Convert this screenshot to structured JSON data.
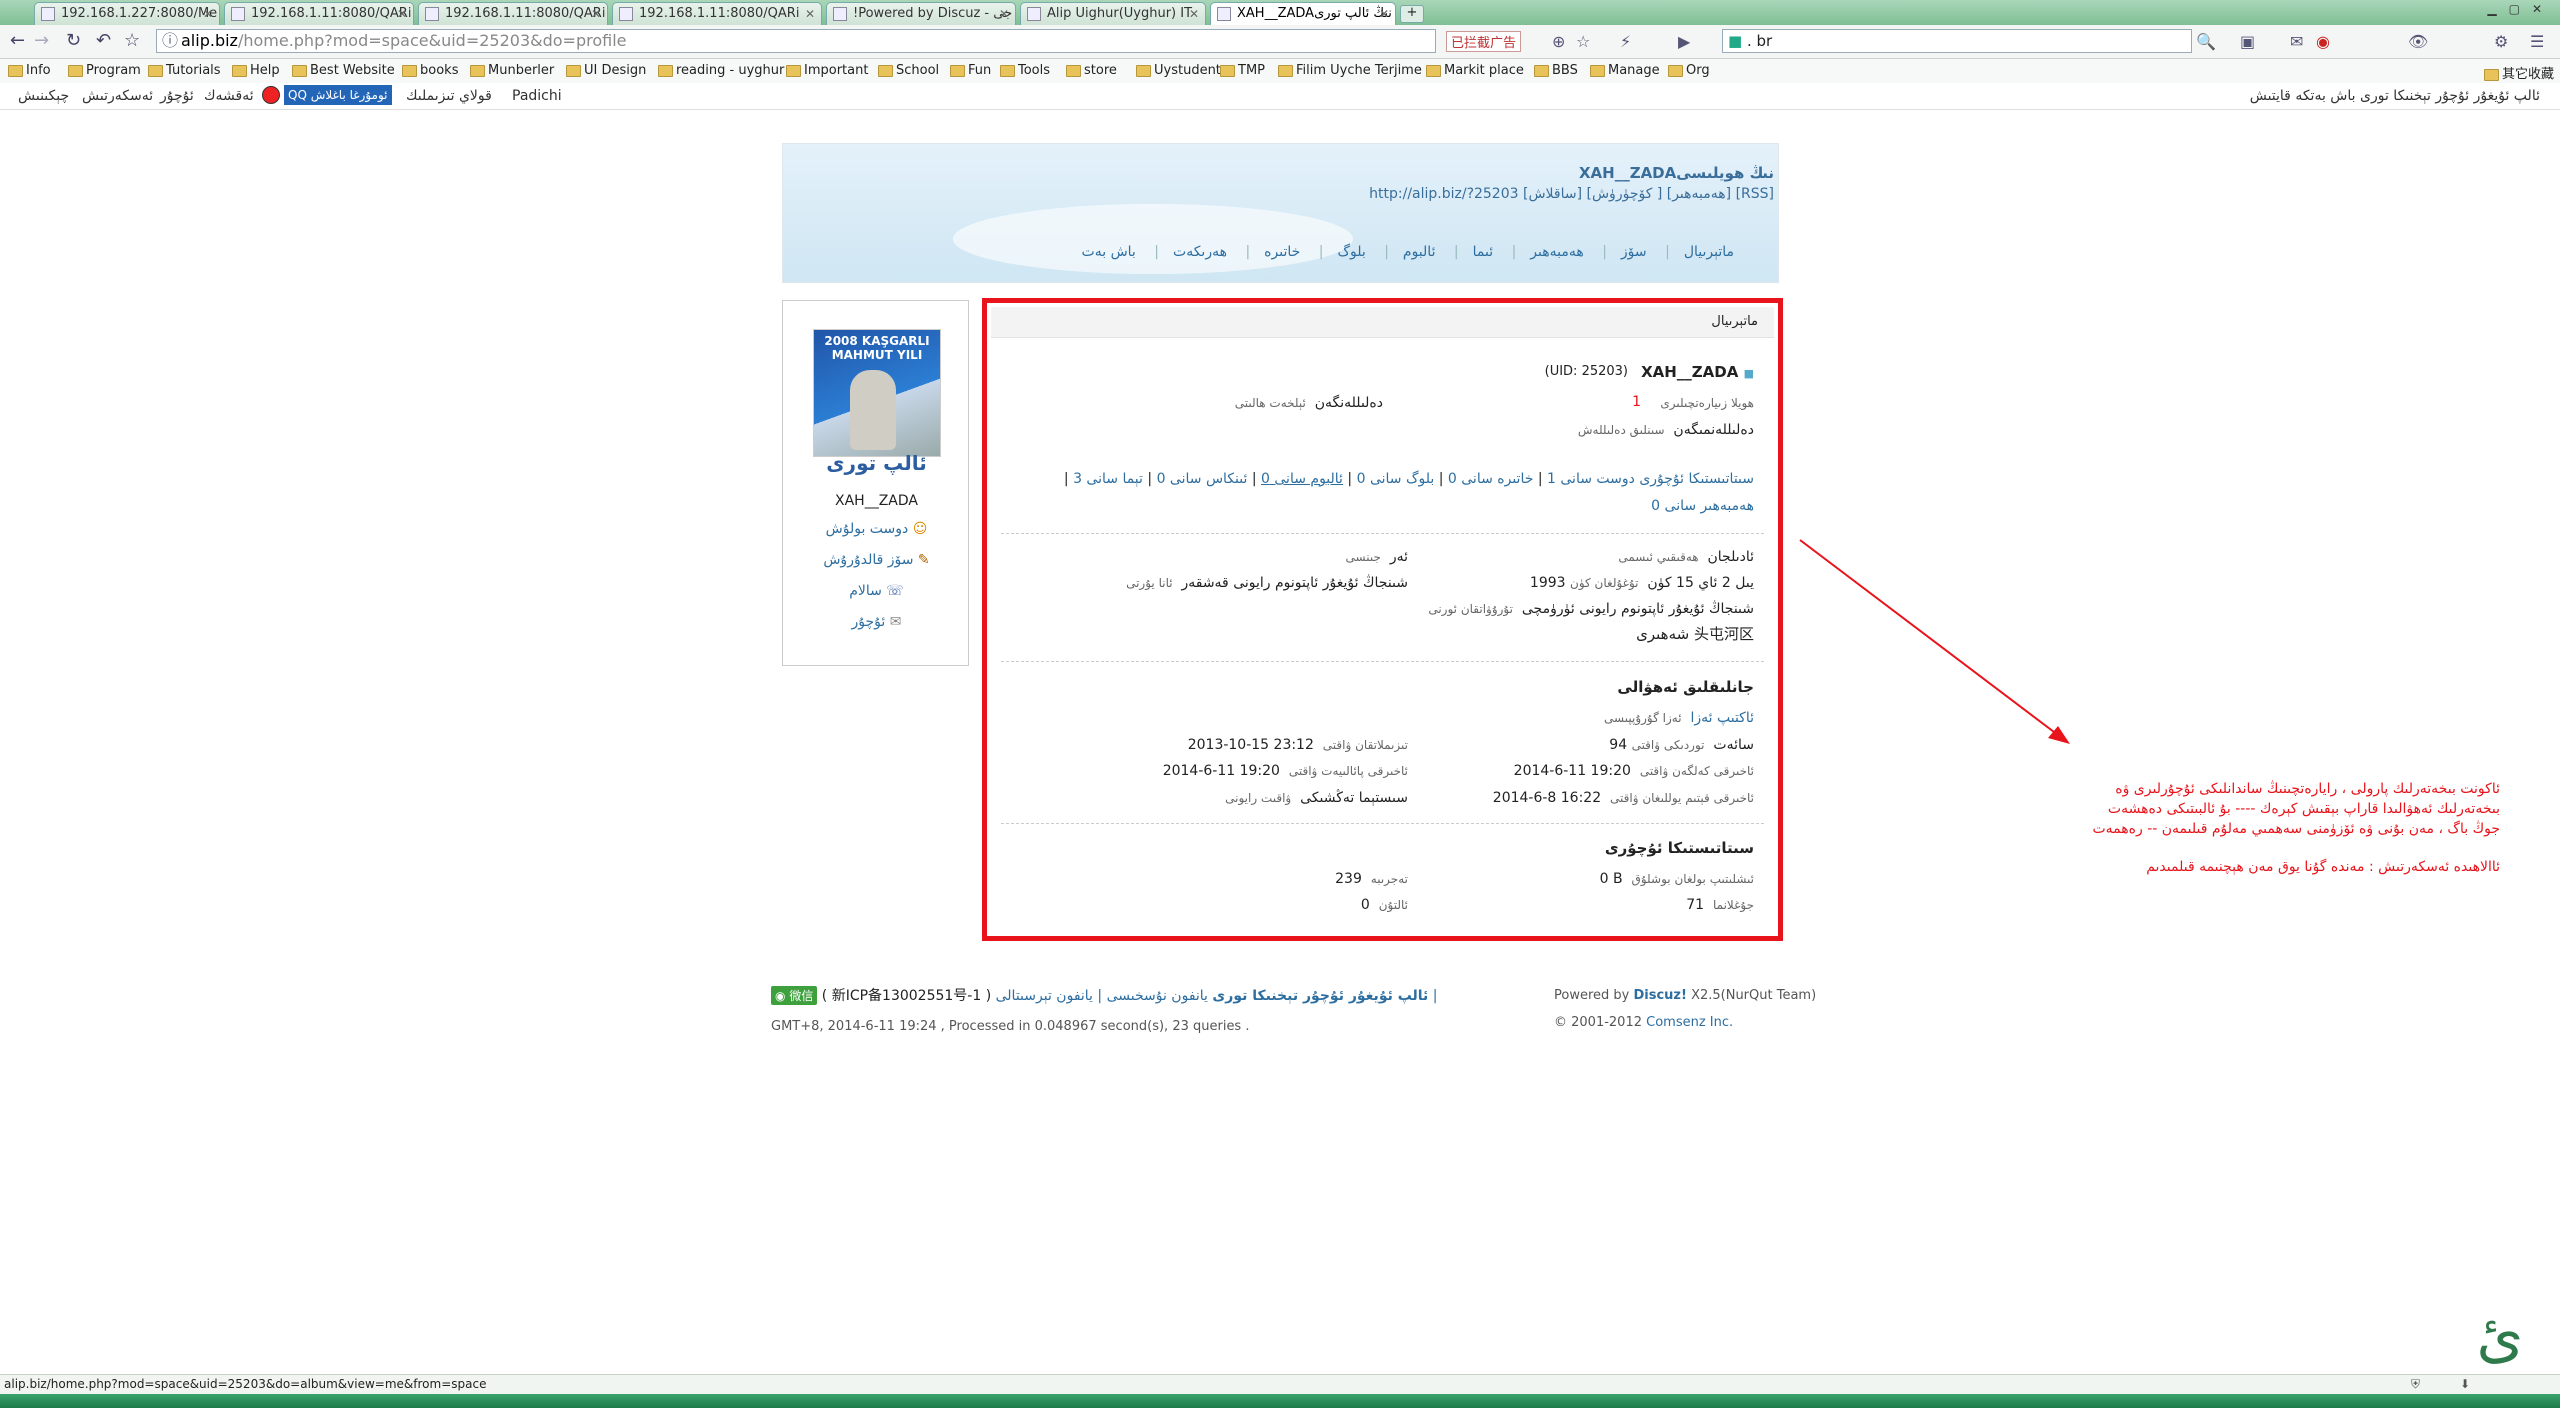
{
  "browser": {
    "tabs": [
      {
        "label": "192.168.1.227:8080/Me"
      },
      {
        "label": "192.168.1.11:8080/QARi"
      },
      {
        "label": "192.168.1.11:8080/QARi"
      },
      {
        "label": "192.168.1.11:8080/QARi"
      },
      {
        "label": "!Powered by Discuz - جى"
      },
      {
        "label": "Alip Uighur(Uyghur) IT"
      },
      {
        "label": "XAH__ZADAنىڭ ئالپ تورى"
      }
    ],
    "url_host": "alip.biz",
    "url_path": "/home.php?mod=space&uid=25203&do=profile",
    "adblock_label": "已拦截广告",
    "search_value": ". br",
    "bookmarks": [
      {
        "label": "Info"
      },
      {
        "label": "Program"
      },
      {
        "label": "Tutorials"
      },
      {
        "label": "Help"
      },
      {
        "label": "Best Website"
      },
      {
        "label": "books"
      },
      {
        "label": "Munberler"
      },
      {
        "label": "UI Design"
      },
      {
        "label": "reading - uyghur"
      },
      {
        "label": "Important"
      },
      {
        "label": "School"
      },
      {
        "label": "Fun"
      },
      {
        "label": "Tools"
      },
      {
        "label": "store"
      },
      {
        "label": "Uystudent"
      },
      {
        "label": "TMP"
      },
      {
        "label": "Filim Uyche Terjime"
      },
      {
        "label": "Markit place"
      },
      {
        "label": "BBS"
      },
      {
        "label": "Manage"
      },
      {
        "label": "Org"
      }
    ],
    "bookmarks_other": "其它收藏",
    "status_url": "alip.biz/home.php?mod=space&uid=25203&do=album&view=me&from=space"
  },
  "discuz_bar": {
    "left_items": [
      "چېكىنىش",
      "ئەسكەرتىش",
      "ئۇچۇر",
      "ئەقشەك"
    ],
    "qq_label": "QQ ئومۇرغا باغلاش",
    "mid_items": [
      "قولاي تىزىملىك",
      "Padichi"
    ],
    "right_text": "ئالپ ئۇيغۇر ئۇچۇر تېخنىكا تورى  باش بەتكە قايتىش"
  },
  "header": {
    "title": "XAH__ZADAنىڭ ھويلىسى",
    "url_line": "http://alip.biz/?25203 [ساقلاش] [كۆچۈرۈش ] [ھەمبەھىر] [RSS]",
    "nav": [
      "باش بەت",
      "ھەرىكەت",
      "خاتىرە",
      "بلوگ",
      "ئالبوم",
      "ئىما",
      "ھەمبەھىر",
      "سۆز",
      "ماتېرىيال"
    ]
  },
  "sidebar": {
    "avatar_text": "2008 KAŞGARLI MAHMUT YILI",
    "logo": "ئالپ تورى",
    "username": "XAH__ZADA",
    "links": [
      "دوست بولۇش",
      "سۆز قالدۇرۇش",
      "سالام",
      "ئۇچۇر"
    ]
  },
  "profile": {
    "header": "ماتېرىيال",
    "name": "XAH__ZADA",
    "uid": "(UID: 25203)",
    "visits_label": "ھويلا زىيارەتچىلىرى",
    "visits": "1",
    "email_label": "ئېلخەت ھالىتى",
    "email_status": "دەلىللەنگەن",
    "video_label": "سىنلىق دەلىللەش",
    "video_status": "دەلىللەنمىگەن",
    "stats": [
      "سىتاتىستىكا ئۇچۇرى",
      "دوست سانى 1",
      "خاتىرە سانى 0",
      "بلوگ سانى 0",
      "ئالبوم سانى 0",
      "تېما سانى 3",
      "ئىنكاس سانى 0"
    ],
    "stats_share": "ھەمبەھىر سانى 0",
    "realname_label": "ھەقىقىي ئىسمى",
    "realname": "ئادىلجان",
    "gender_label": "جىنسى",
    "gender": "ئەر",
    "birthday_label": "تۇغۇلغان كۈن",
    "birthday": "1993 يىل 2 ئاي 15 كۈن",
    "hometown_label": "ئانا يۇرتى",
    "hometown": "شىنجاڭ ئۇيغۇر ئاپتونوم رايونى قەشقەر",
    "residence_label": "تۇرۇۋاتقان ئورنى",
    "residence": "شىنجاڭ ئۇيغۇر ئاپتونوم رايونى ئۈرۈمچى",
    "residence2": "شەھىرى 头屯河区",
    "activity_title": "جانلىقلىق ئەھۋالى",
    "group_label": "ئەزا گۇرۇپپىسى",
    "group": "ئاكتىپ ئەزا",
    "online_label": "توردىكى ۋاقتى",
    "online": "94 سائەت",
    "regtime_label": "تىزىملاتقان ۋاقتى",
    "regtime": "2013-10-15 23:12",
    "lastvisit_label": "ئاخىرقى كەلگەن ۋاقتى",
    "lastvisit": "2014-6-11 19:20",
    "lastactive_label": "ئاخىرقى پائالىيەت ۋاقتى",
    "lastactive": "2014-6-11 19:20",
    "lastpost_label": "ئاخىرقى قېتىم يوللىغان ۋاقتى",
    "lastpost": "2014-6-8 16:22",
    "timezone_label": "ۋاقىت رايونى",
    "timezone": "سىستېما تەڭشىكى",
    "statistics_title": "سىتاتىستىكا ئۇچۇرى",
    "space_label": "ئىشلىتىپ بولغان بوشلۇق",
    "space": "0 B",
    "exp_label": "تەجرىبە",
    "exp": "239",
    "credits_label": "جۇغلانما",
    "credits": "71",
    "coins_label": "ئالتۇن",
    "coins": "0"
  },
  "footer": {
    "links": "يانفون نۇسخىسى | يانفون تېرسىتالى |",
    "site": "ئالپ ئۇيغۇر ئۇچۇر تېخنىكا تورى",
    "icp": "( 新ICP备13002551号-1 )",
    "wechat": "微信",
    "time_line": "GMT+8, 2014-6-11 19:24 , Processed in 0.048967 second(s), 23 queries .",
    "powered": "Powered by ",
    "discuz": "Discuz!",
    "version": " X2.5(NurQut Team)",
    "copyright": "© 2001-2012 ",
    "comsenz": "Comsenz Inc."
  },
  "annotation": {
    "line1": "ئاكونت بىخەتەرلىك پارولى ، رايارەتچىنىڭ ساندانلىكى ئۇچۇرلىرى ۋە",
    "line2": "بىخەتەرلىك ئەھۋالىدا قاراپ بېقىش كېرەك ---- بۇ ئالبىتىكى دەھشەت",
    "line3": "جوڭ باگ ، مەن بۇنى  ۋە ئۆزۈمنى سەھمىي مەلۇم قىلىمەن -- رەھمەت",
    "line4": "ئاالاھىدە ئەسكەرتىش : مەندە گۇنا يوق مەن ھېچنىمە قىلمىدىم"
  },
  "colors": {
    "accent_red": "#e8131b",
    "link_blue": "#2d6ea0",
    "chrome_green": "#7fbf95"
  }
}
